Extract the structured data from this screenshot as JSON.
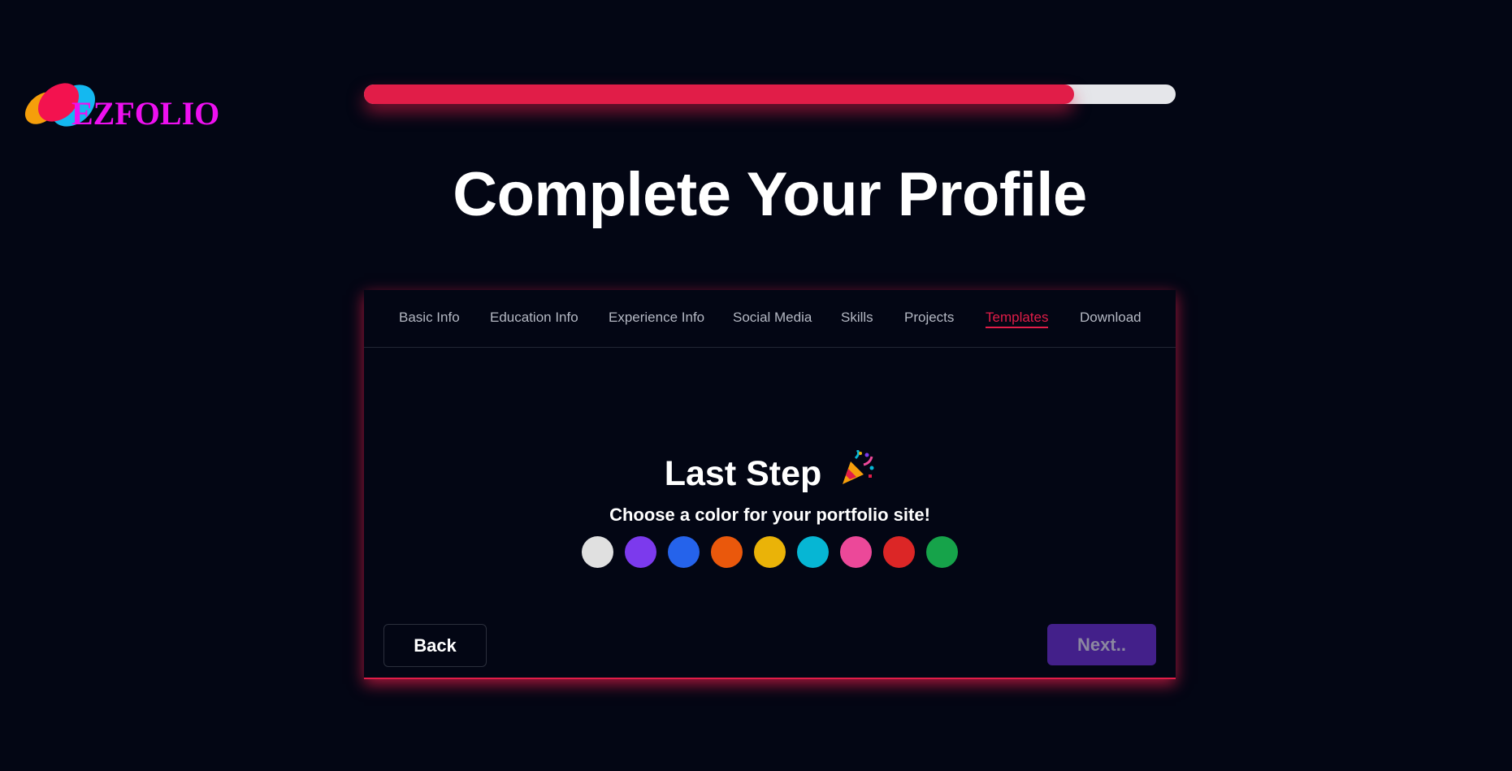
{
  "logo": {
    "text": "EZFOLIO"
  },
  "progress": {
    "percent": 87.5,
    "fill_color": "#e11d48",
    "track_color": "#e5e6ea"
  },
  "page_title": "Complete Your Profile",
  "tabs": [
    {
      "label": "Basic Info",
      "active": false
    },
    {
      "label": "Education Info",
      "active": false
    },
    {
      "label": "Experience Info",
      "active": false
    },
    {
      "label": "Social Media",
      "active": false
    },
    {
      "label": "Skills",
      "active": false
    },
    {
      "label": "Projects",
      "active": false
    },
    {
      "label": "Templates",
      "active": true
    },
    {
      "label": "Download",
      "active": false
    }
  ],
  "step": {
    "title": "Last Step",
    "title_icon": "party-popper-icon",
    "subtitle": "Choose a color for your portfolio site!"
  },
  "colors": [
    {
      "name": "white",
      "hex": "#e0e0e0"
    },
    {
      "name": "purple",
      "hex": "#7c3aed"
    },
    {
      "name": "blue",
      "hex": "#2563eb"
    },
    {
      "name": "orange",
      "hex": "#ea580c"
    },
    {
      "name": "yellow",
      "hex": "#eab308"
    },
    {
      "name": "cyan",
      "hex": "#06b6d4"
    },
    {
      "name": "pink",
      "hex": "#ec4899"
    },
    {
      "name": "red",
      "hex": "#dc2626"
    },
    {
      "name": "green",
      "hex": "#16a34a"
    }
  ],
  "buttons": {
    "back": "Back",
    "next": "Next.."
  }
}
